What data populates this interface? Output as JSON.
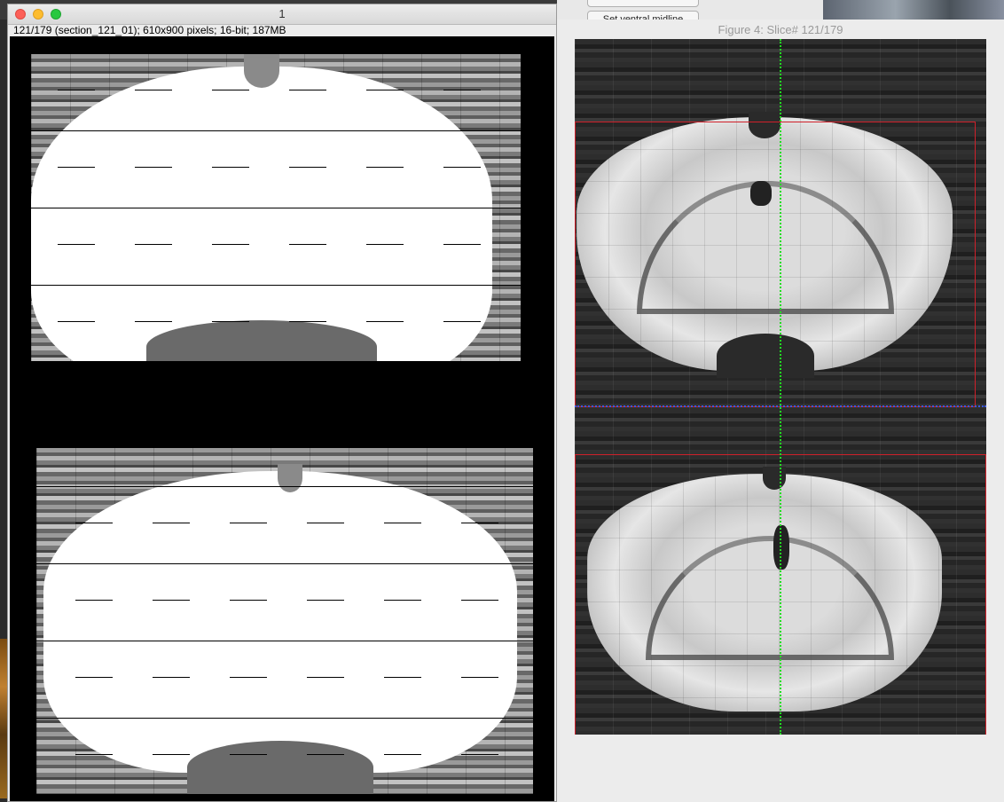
{
  "background": {
    "button_label": "Set ventral midline"
  },
  "image_window": {
    "title": "1",
    "info": "121/179 (section_121_01); 610x900 pixels; 16-bit; 187MB",
    "controls": [
      "close",
      "minimize",
      "zoom"
    ]
  },
  "figure_window": {
    "title": "Figure 4: Slice# 121/179",
    "overlay_colors": {
      "roi_box": "#d0202a",
      "midline": "#22dd22",
      "boundary": "#3b57e0"
    }
  }
}
